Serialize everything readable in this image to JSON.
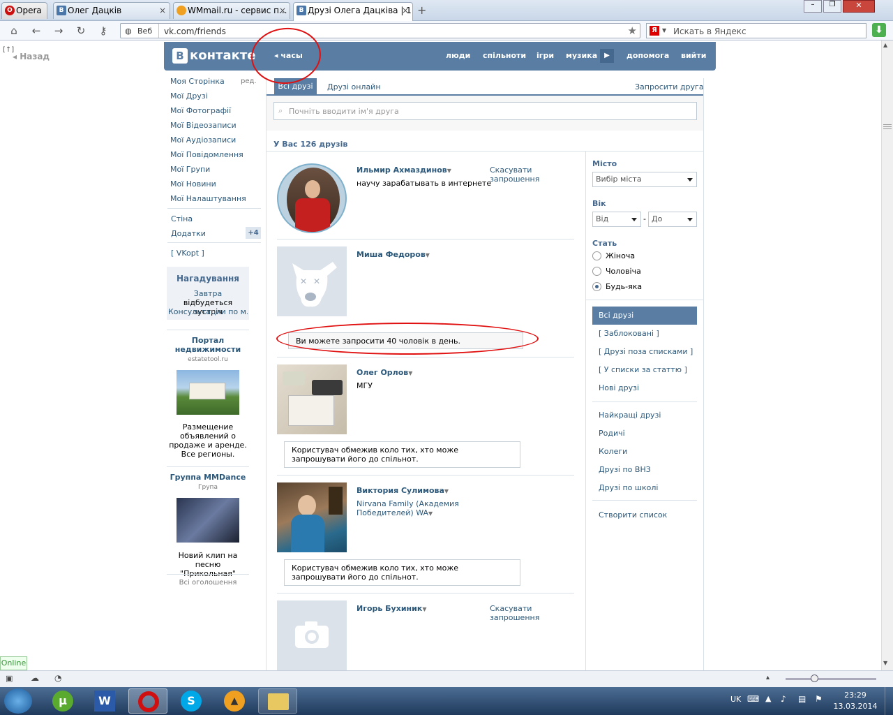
{
  "browser": {
    "tabs": [
      "Opera",
      "Олег Дацків",
      "WMmail.ru - сервис п...",
      "Друзі Олега Дацківа | 1..."
    ],
    "web_label": "Веб",
    "url": "vk.com/friends",
    "search_placeholder": "Искать в Яндекс",
    "back_label": "Назад",
    "status_online": "Online"
  },
  "vk": {
    "logo": "контакте",
    "logo_letter": "B",
    "clock_link": "часы",
    "nav": [
      "люди",
      "спільноти",
      "ігри",
      "музика",
      "допомога",
      "вийти"
    ],
    "left_menu": [
      "Моя Сторінка",
      "Мої Друзі",
      "Мої Фотографії",
      "Мої Відеозаписи",
      "Мої Аудіозаписи",
      "Мої Повідомлення",
      "Мої Групи",
      "Мої Новини",
      "Мої Налаштування"
    ],
    "edit_label": "ред.",
    "wall": "Стіна",
    "apps": "Додатки",
    "apps_count": "+4",
    "vkopt": "[ VKopt ]",
    "reminder_title": "Нагадування",
    "reminder_when": "Завтра",
    "reminder_text": " відбудеться зустріч",
    "reminder_event": "Консультации по м...",
    "ad1_title": "Портал недвижимости",
    "ad1_site": "estatetool.ru",
    "ad1_text": "Размещение объявлений о продаже и аренде. Все регионы.",
    "ad2_title": "Группа MMDance",
    "ad2_sub": "Група",
    "ad2_text": "Новий клип на песню \"Прикольная\"",
    "all_ads": "Всі оголошення",
    "tabs": [
      "Всі друзі",
      "Друзі онлайн"
    ],
    "invite_friend": "Запросити друга",
    "search_placeholder": "Почніть вводити ім'я друга",
    "friends_count": "У Вас 126 друзів",
    "friends": [
      {
        "name": "Ильмир Ахмаздинов",
        "status": "научу зарабатывать в интернете",
        "action": "Скасувати запрошення"
      },
      {
        "name": "Миша Федоров",
        "notice": "Ви можете запросити 40 чоловік в день."
      },
      {
        "name": "Олег Орлов",
        "status": "МГУ",
        "notice": "Користувач обмежив коло тих, хто може запрошувати його до спільнот."
      },
      {
        "name": "Виктория Сулимова",
        "status": "Nirvana Family (Академия Победителей) WA",
        "notice": "Користувач обмежив коло тих, хто може запрошувати його до спільнот."
      },
      {
        "name": "Игорь Бухиник",
        "action": "Скасувати запрошення"
      }
    ],
    "filters": {
      "city_label": "Місто",
      "city_value": "Вибір міста",
      "age_label": "Вік",
      "age_from": "Від",
      "age_dash": "-",
      "age_to": "До",
      "sex_label": "Стать",
      "sex_options": [
        "Жіноча",
        "Чоловіча",
        "Будь-яка"
      ],
      "sex_selected": 2
    },
    "right_menu": [
      "Всі друзі",
      "[ Заблоковані ]",
      "[ Друзі поза списками ]",
      "[ У списки за статтю ]",
      "Нові друзі",
      "Найкращі друзі",
      "Родичі",
      "Колеги",
      "Друзі по ВНЗ",
      "Друзі по школі",
      "Створити список"
    ]
  },
  "taskbar": {
    "lang": "UK",
    "time": "23:29",
    "date": "13.03.2014"
  },
  "colors": {
    "vk_blue": "#597da3",
    "link": "#2b587a",
    "annotation": "#e01010"
  }
}
